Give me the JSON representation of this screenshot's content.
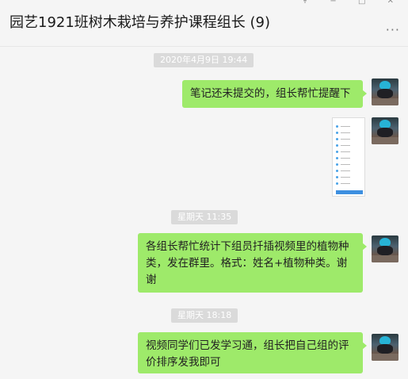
{
  "chat": {
    "title": "园艺1921班树木栽培与养护课程组长 (9)",
    "window_controls": "↟ − □ ✕",
    "more_icon": "···"
  },
  "timestamps": [
    "2020年4月9日 19:44",
    "星期天 11:35",
    "星期天 18:18"
  ],
  "messages": [
    {
      "sender": "me",
      "type": "text",
      "text": "笔记还未提交的，组长帮忙提醒下"
    },
    {
      "sender": "me",
      "type": "image",
      "rows": 10
    },
    {
      "sender": "me",
      "type": "text",
      "text": "各组长帮忙统计下组员扦插视频里的植物种类，发在群里。格式：姓名+植物种类。谢谢"
    },
    {
      "sender": "me",
      "type": "text",
      "text": "视频同学们已发学习通，组长把自己组的评价排序发我即可"
    }
  ],
  "colors": {
    "bubble": "#9eea6a",
    "background": "#f5f5f5",
    "timestamp_bg": "#dadada"
  }
}
